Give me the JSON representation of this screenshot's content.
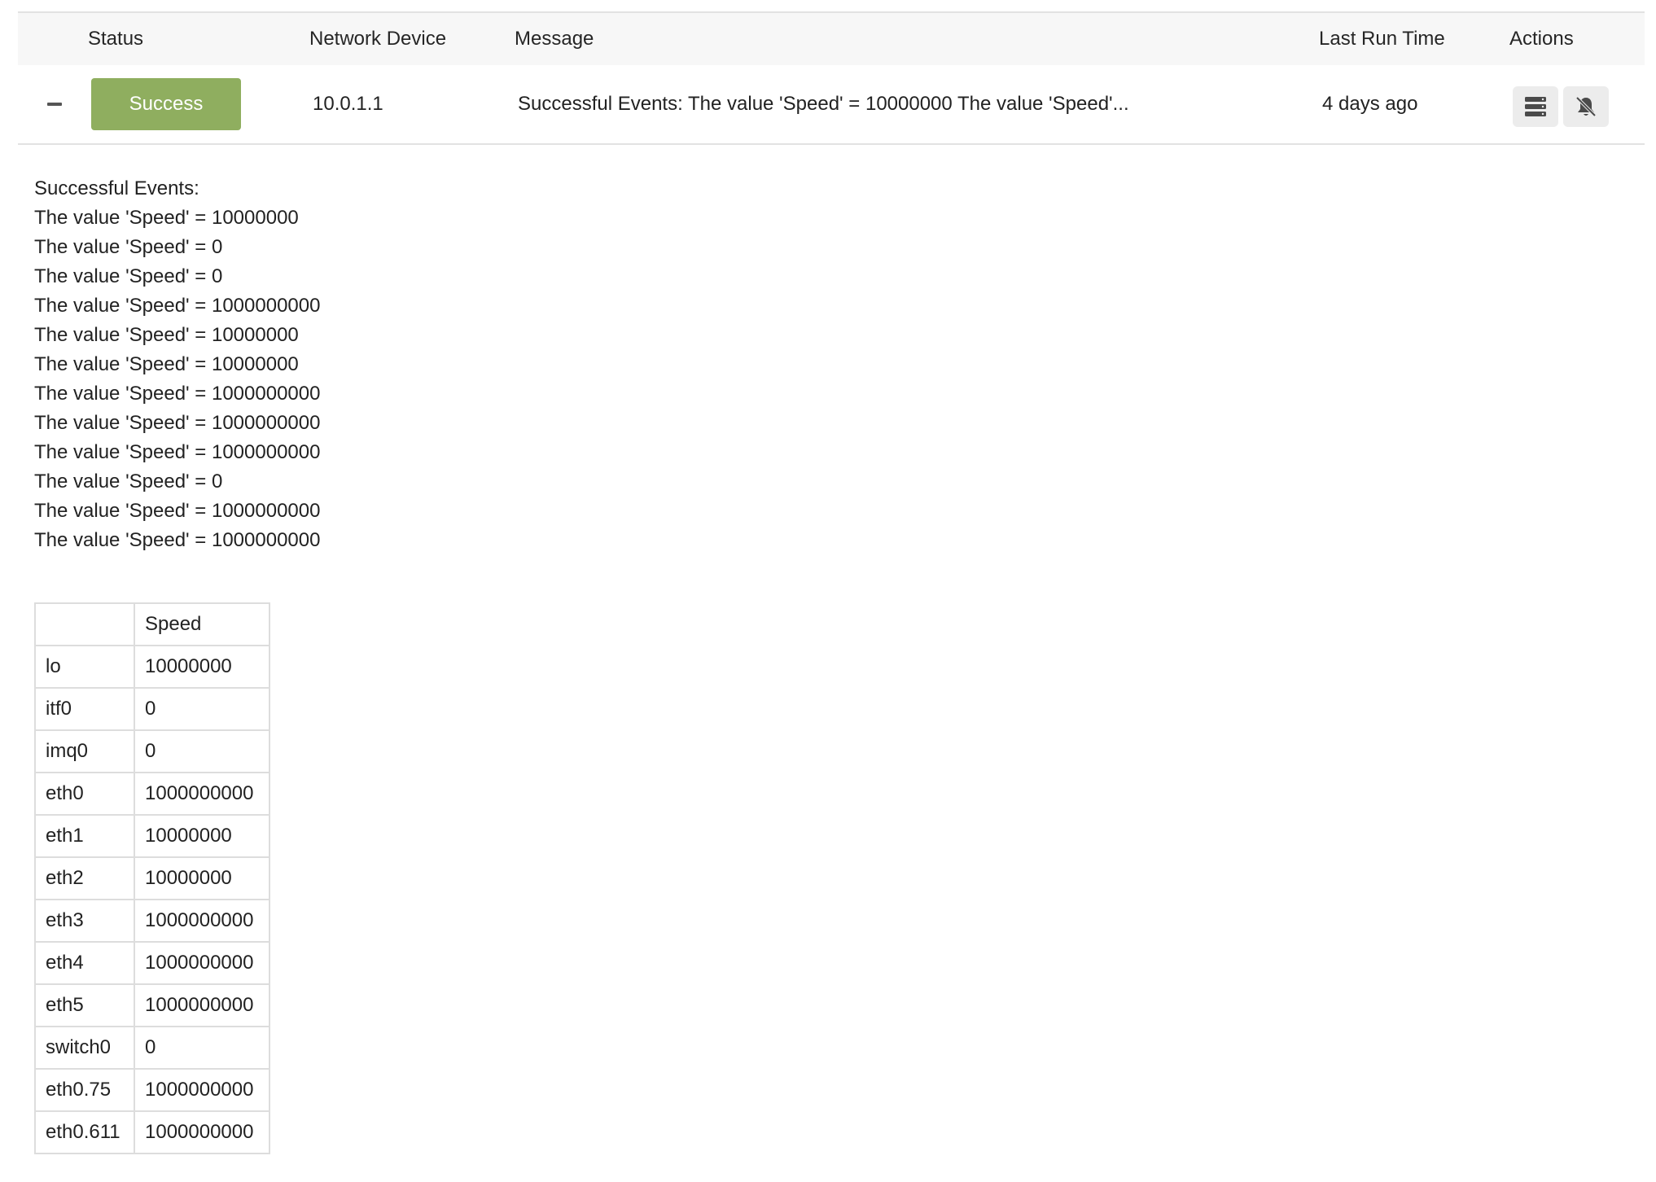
{
  "header": {
    "status": "Status",
    "network_device": "Network Device",
    "message": "Message",
    "last_run_time": "Last Run Time",
    "actions": "Actions"
  },
  "row": {
    "status": "Success",
    "status_color": "#8fae5f",
    "device": "10.0.1.1",
    "message": "Successful Events: The value 'Speed' = 10000000 The value 'Speed'...",
    "last_run": "4 days ago",
    "actions": [
      "server-list-icon",
      "bell-off-icon"
    ]
  },
  "details": {
    "heading": "Successful Events:",
    "lines": [
      "The value 'Speed' = 10000000",
      "The value 'Speed' = 0",
      "The value 'Speed' = 0",
      "The value 'Speed' = 1000000000",
      "The value 'Speed' = 10000000",
      "The value 'Speed' = 10000000",
      "The value 'Speed' = 1000000000",
      "The value 'Speed' = 1000000000",
      "The value 'Speed' = 1000000000",
      "The value 'Speed' = 0",
      "The value 'Speed' = 1000000000",
      "The value 'Speed' = 1000000000"
    ]
  },
  "table": {
    "header": [
      "",
      "Speed"
    ],
    "rows": [
      [
        "lo",
        "10000000"
      ],
      [
        "itf0",
        "0"
      ],
      [
        "imq0",
        "0"
      ],
      [
        "eth0",
        "1000000000"
      ],
      [
        "eth1",
        "10000000"
      ],
      [
        "eth2",
        "10000000"
      ],
      [
        "eth3",
        "1000000000"
      ],
      [
        "eth4",
        "1000000000"
      ],
      [
        "eth5",
        "1000000000"
      ],
      [
        "switch0",
        "0"
      ],
      [
        "eth0.75",
        "1000000000"
      ],
      [
        "eth0.611",
        "1000000000"
      ]
    ]
  }
}
